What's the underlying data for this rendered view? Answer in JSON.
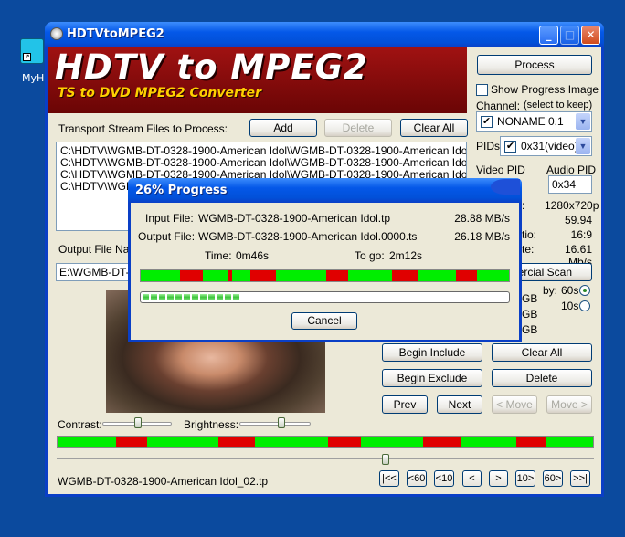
{
  "desktop": {
    "icon_label": "MyHl"
  },
  "window": {
    "title": "HDTVtoMPEG2"
  },
  "banner": {
    "title": "HDTV to MPEG2",
    "subtitle": "TS to DVD MPEG2 Converter"
  },
  "files": {
    "label": "Transport Stream Files to Process:",
    "add": "Add",
    "delete": "Delete",
    "clear_all": "Clear All",
    "items": [
      "C:\\HDTV\\WGMB-DT-0328-1900-American Idol\\WGMB-DT-0328-1900-American Idol.tp",
      "C:\\HDTV\\WGMB-DT-0328-1900-American Idol\\WGMB-DT-0328-1900-American Idol_01.tp",
      "C:\\HDTV\\WGMB-DT-0328-1900-American Idol\\WGMB-DT-0328-1900-American Idol_02.tp",
      "C:\\HDTV\\WGM"
    ]
  },
  "output": {
    "label": "Output File Nam",
    "value": "E:\\WGMB-DT-"
  },
  "side": {
    "process": "Process",
    "show_progress": "Show Progress Image",
    "channel_label": "Channel:",
    "channel_hint": "(select to keep)",
    "channel_value": "NONAME 0.1",
    "pids_label": "PIDs:",
    "pids_value": "0x31(video)",
    "video_pid_label": "Video PID",
    "audio_pid_label": "Audio PID",
    "audio_pid_value": "0x34",
    "rows": [
      {
        "label": ":",
        "value": "1280x720p"
      },
      {
        "label": "",
        "value": "59.94"
      },
      {
        "label": "tio:",
        "value": "16:9"
      },
      {
        "label": "te:",
        "value": "16.61 Mb/s"
      }
    ],
    "commercial_scan": "nercial Scan",
    "by_label": "by:",
    "opt_60": "60s",
    "opt_10": "10s",
    "gb_labels": [
      "GB",
      "GB",
      "GB"
    ],
    "begin_include": "Begin Include",
    "clear_all": "Clear All",
    "begin_exclude": "Begin Exclude",
    "delete": "Delete",
    "prev": "Prev",
    "next": "Next",
    "move_left": "< Move",
    "move_right": "Move >"
  },
  "sliders": {
    "contrast": "Contrast:",
    "brightness": "Brightness:"
  },
  "status_file": "WGMB-DT-0328-1900-American Idol_02.tp",
  "nav": [
    "|<<",
    "<60",
    "<10",
    "<",
    ">",
    "10>",
    "60>",
    ">>|"
  ],
  "dialog": {
    "title": "26% Progress",
    "input_label": "Input File:",
    "input_file": "WGMB-DT-0328-1900-American Idol.tp",
    "input_rate": "28.88 MB/s",
    "output_label": "Output File:",
    "output_file": "WGMB-DT-0328-1900-American Idol.0000.ts",
    "output_rate": "26.18 MB/s",
    "time_label": "Time:",
    "time_value": "0m46s",
    "togo_label": "To go:",
    "togo_value": "2m12s",
    "progress": 0.26,
    "cancel": "Cancel"
  },
  "colors": {
    "include": "#00ee00",
    "exclude": "#e00000",
    "titlebar": "#0458e8",
    "banner": "#8a0c0c"
  }
}
